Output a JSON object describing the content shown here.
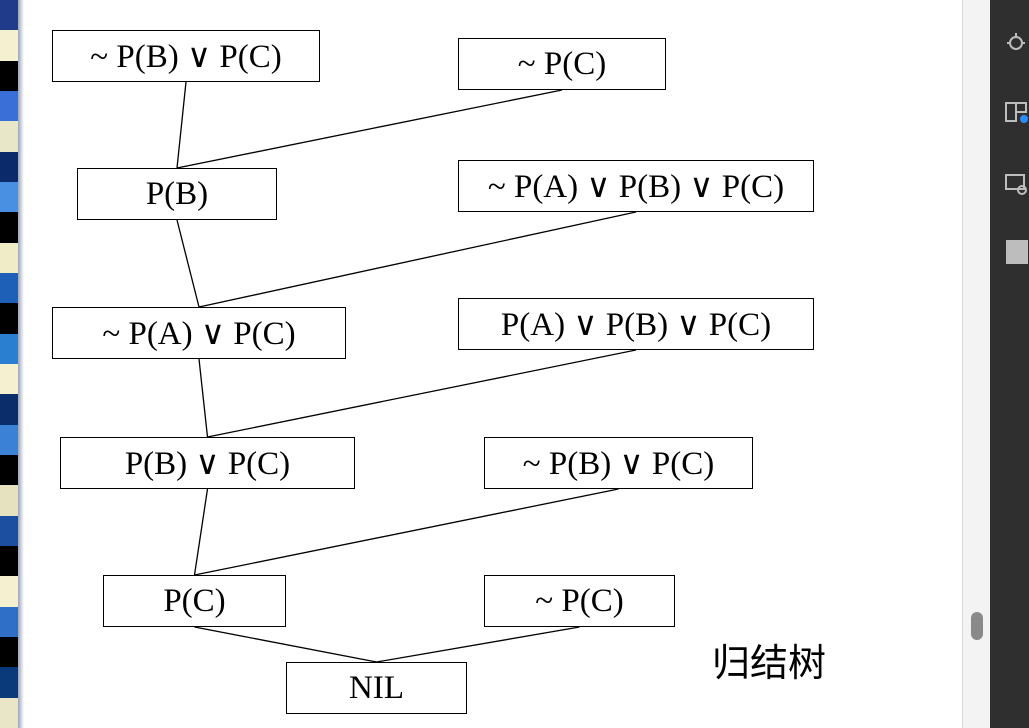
{
  "diagram": {
    "caption": "归结树",
    "nodes": [
      {
        "id": "n1",
        "label": "~ P(B) ∨ P(C)"
      },
      {
        "id": "n2",
        "label": "~ P(C)"
      },
      {
        "id": "n3",
        "label": "P(B)"
      },
      {
        "id": "n4",
        "label": "~ P(A) ∨ P(B) ∨ P(C)"
      },
      {
        "id": "n5",
        "label": "~ P(A) ∨ P(C)"
      },
      {
        "id": "n6",
        "label": "P(A) ∨ P(B) ∨ P(C)"
      },
      {
        "id": "n7",
        "label": "P(B) ∨ P(C)"
      },
      {
        "id": "n8",
        "label": "~ P(B) ∨ P(C)"
      },
      {
        "id": "n9",
        "label": "P(C)"
      },
      {
        "id": "n10",
        "label": "~ P(C)"
      },
      {
        "id": "n11",
        "label": "NIL"
      }
    ],
    "edges": [
      {
        "from": "n1",
        "to": "n3"
      },
      {
        "from": "n2",
        "to": "n3"
      },
      {
        "from": "n3",
        "to": "n5"
      },
      {
        "from": "n4",
        "to": "n5"
      },
      {
        "from": "n5",
        "to": "n7"
      },
      {
        "from": "n6",
        "to": "n7"
      },
      {
        "from": "n7",
        "to": "n9"
      },
      {
        "from": "n8",
        "to": "n9"
      },
      {
        "from": "n9",
        "to": "n11"
      },
      {
        "from": "n10",
        "to": "n11"
      }
    ]
  },
  "left_strip": {
    "colors": [
      "#1f3b8a",
      "#f4f0d0",
      "#000000",
      "#3a6fd8",
      "#e8e8c8",
      "#0a2a6a",
      "#4a90e2",
      "#000000",
      "#f0ecc8",
      "#1e5fb8",
      "#000000",
      "#2a7fd0",
      "#f4f0d0",
      "#0b2e6b",
      "#3b82d6",
      "#000000",
      "#e6e2c0",
      "#1c4fa0",
      "#000000",
      "#f4f0d0",
      "#2f6fc8",
      "#000000",
      "#0a3a7a",
      "#e8e6c6"
    ]
  },
  "right_panel": {
    "icons": [
      "bug-icon",
      "layers-icon",
      "screen-search-icon",
      "square-icon"
    ]
  }
}
